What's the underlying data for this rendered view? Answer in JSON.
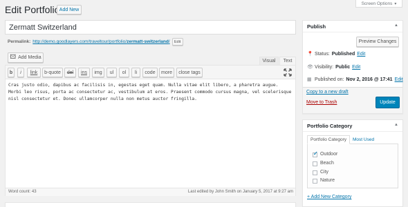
{
  "header": {
    "title": "Edit Portfolio",
    "add_new": "Add New",
    "screen_options": "Screen Options"
  },
  "post": {
    "title": "Zermatt Switzerland",
    "permalink_label": "Permalink:",
    "permalink_base": "http://demo.goodlayers.com/traveltour/portfolio/",
    "permalink_slug": "zermatt-switzerland",
    "permalink_end": "/",
    "edit_label": "Edit"
  },
  "editor": {
    "add_media": "Add Media",
    "tab_visual": "Visual",
    "tab_text": "Text",
    "quicktags": [
      "b",
      "i",
      "link",
      "b-quote",
      "del",
      "ins",
      "img",
      "ul",
      "ol",
      "li",
      "code",
      "more",
      "close tags"
    ],
    "content": "Cras justo odio, dapibus ac facilisis in, egestas eget quam. Nulla vitae elit libero, a pharetra augue.\nMorbi leo risus, porta ac consectetur ac, vestibulum at eros. Praesent commodo cursus magna, vel scelerisque\nnisl consectetur et. Donec ullamcorper nulla non metus auctor fringilla.",
    "word_count": "Word count: 43",
    "last_edited": "Last edited by John Smith on January 5, 2017 at 9:27 am"
  },
  "publish": {
    "title": "Publish",
    "preview": "Preview Changes",
    "status_label": "Status:",
    "status_value": "Published",
    "status_edit": "Edit",
    "visibility_label": "Visibility:",
    "visibility_value": "Public",
    "visibility_edit": "Edit",
    "published_label": "Published on:",
    "published_value": "Nov 2, 2016 @ 17:41",
    "published_edit": "Edit",
    "copy_draft": "Copy to a new draft",
    "trash": "Move to Trash",
    "update": "Update"
  },
  "category": {
    "title": "Portfolio Category",
    "tab_all": "Portfolio Category",
    "tab_used": "Most Used",
    "items": [
      {
        "label": "Outdoor",
        "checked": true
      },
      {
        "label": "Beach",
        "checked": false
      },
      {
        "label": "City",
        "checked": false
      },
      {
        "label": "Nature",
        "checked": false
      }
    ],
    "add_new": "+ Add New Category"
  },
  "colors": {
    "primary": "#0085ba",
    "link": "#0073aa",
    "trash": "#a00"
  }
}
